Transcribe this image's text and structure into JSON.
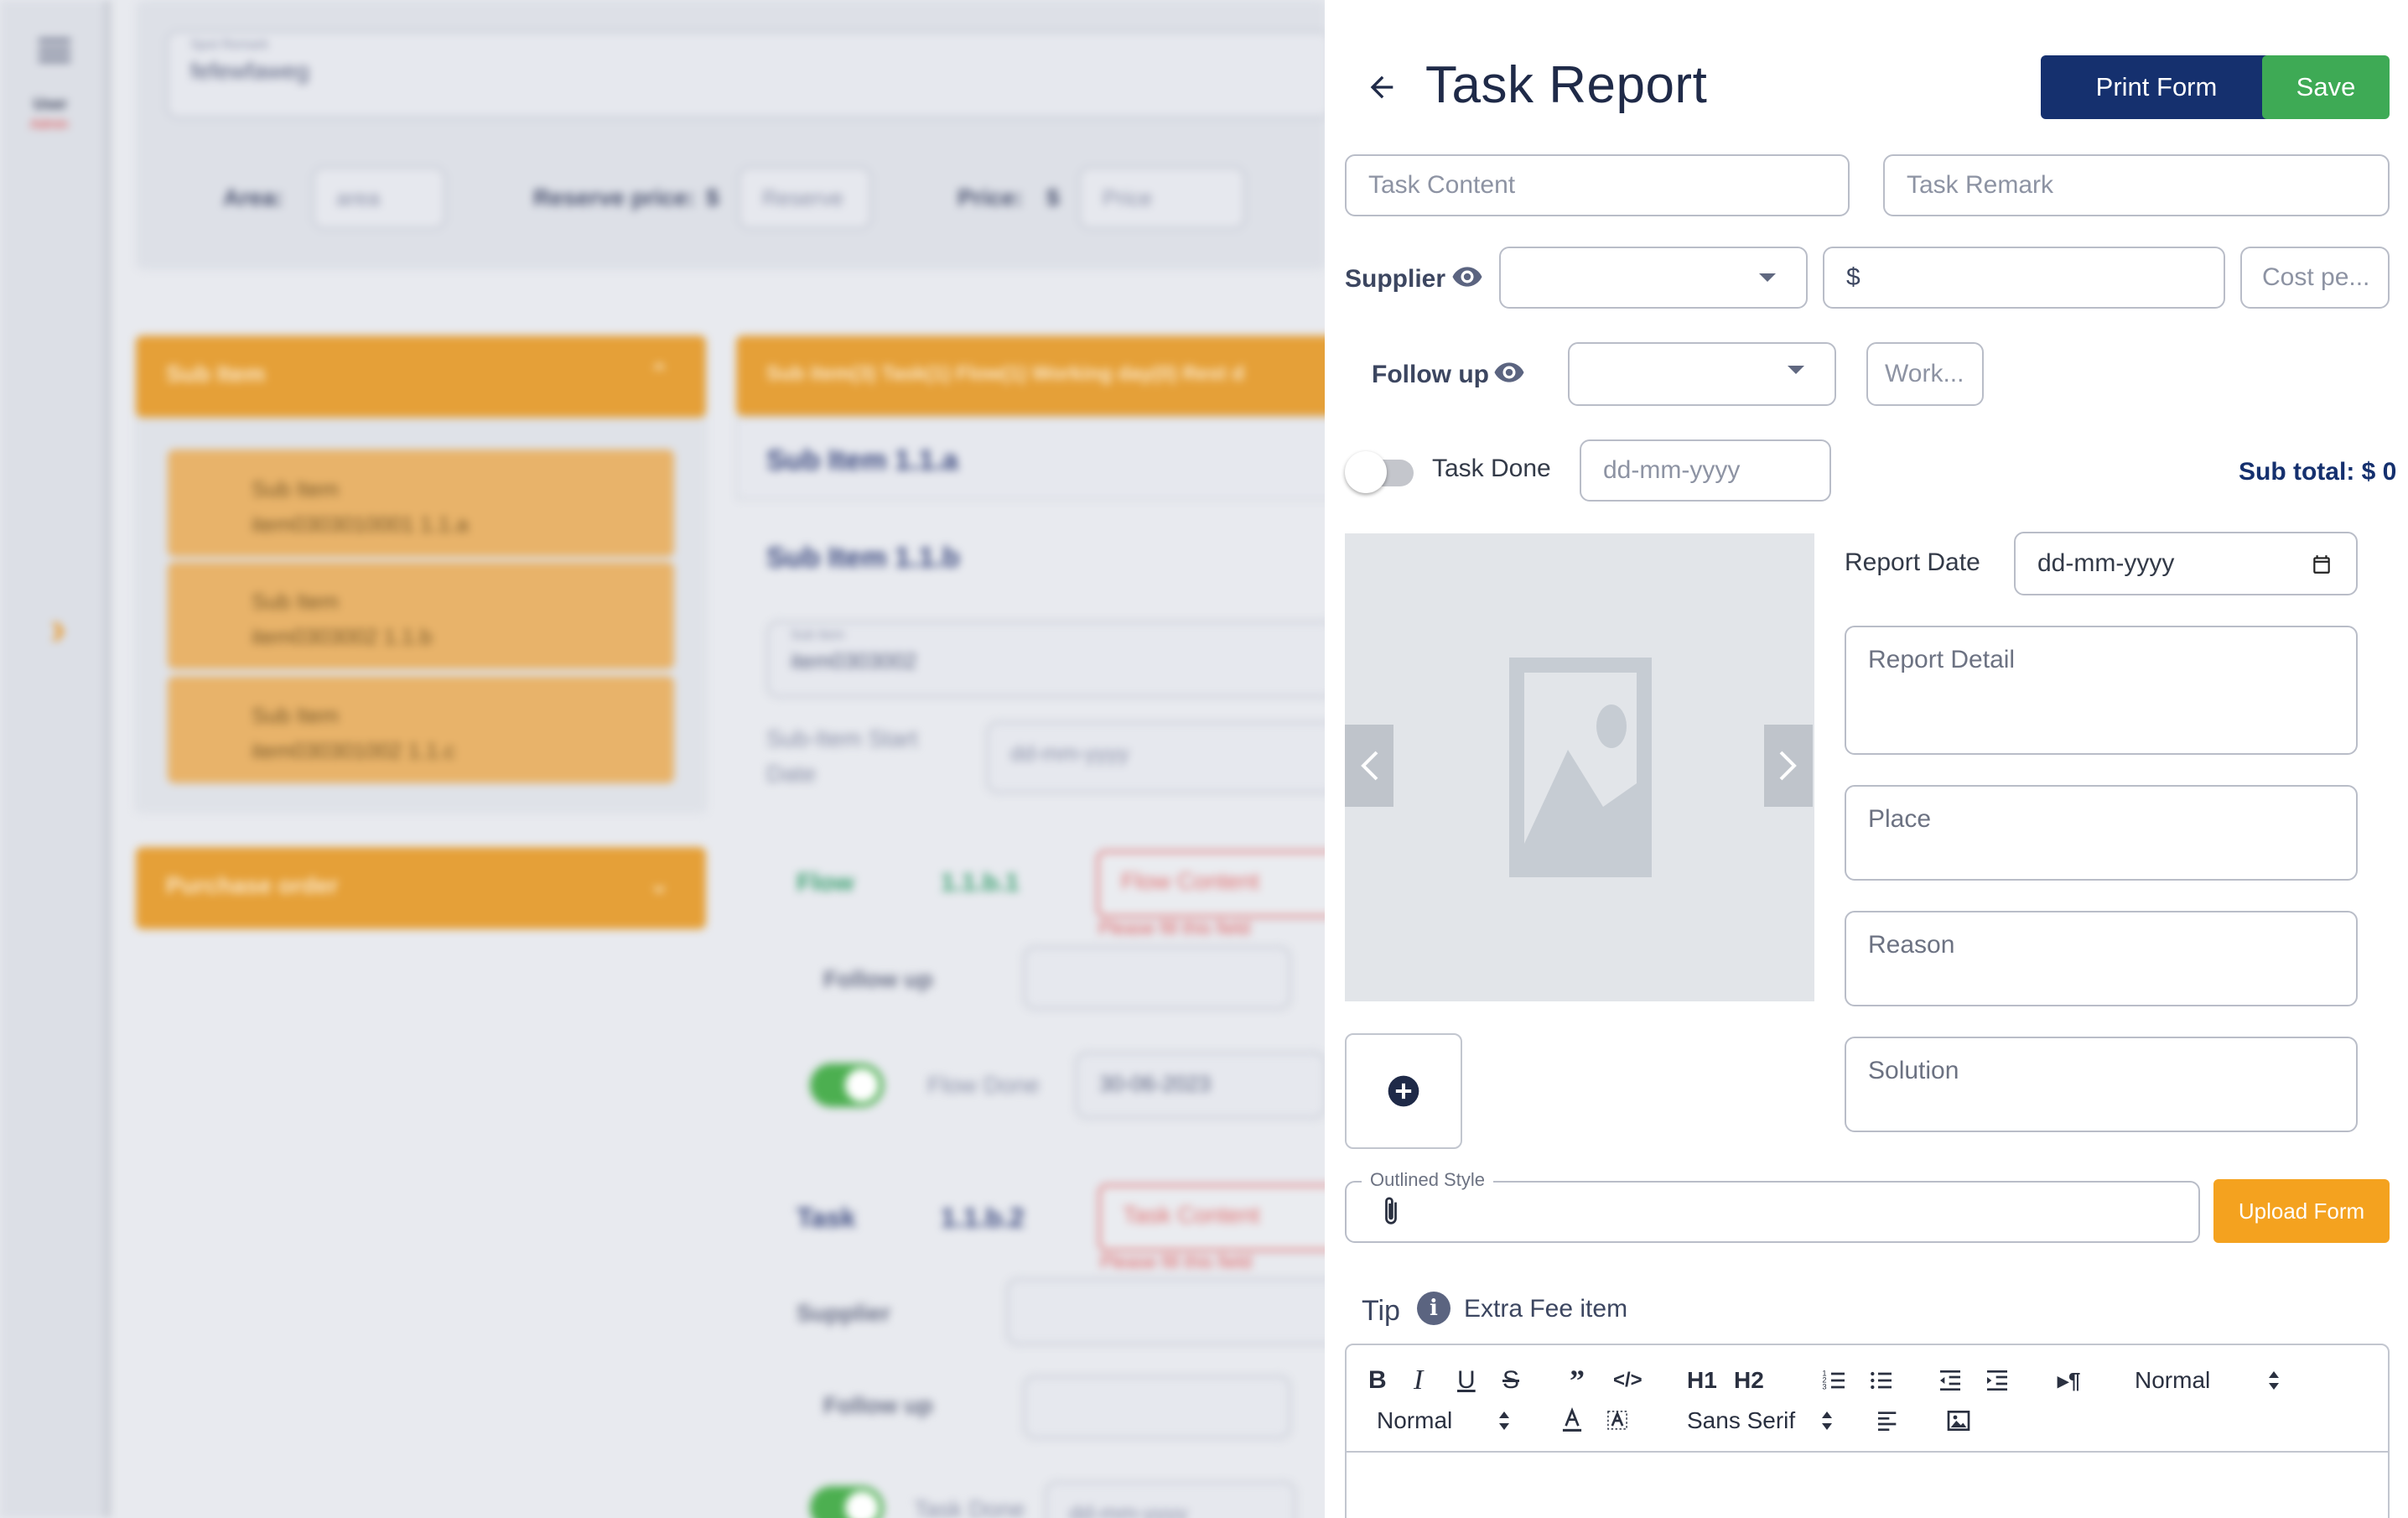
{
  "background": {
    "sidebar": {
      "user_label": "User",
      "role_label": "Admin"
    },
    "top_form": {
      "spot_remark_label": "Spot Remark",
      "spot_remark_value": "fefewfaweg",
      "area_label": "Area:",
      "area_placeholder": "area",
      "reserve_price_label": "Reserve price:",
      "reserve_currency": "$",
      "reserve_placeholder": "Reserve",
      "price_label": "Price:",
      "price_currency": "$",
      "price_placeholder": "Price"
    },
    "sub_item_panel": {
      "header": "Sub Item",
      "items": [
        {
          "title": "Sub Item",
          "code": "item0303010001 1.1.a"
        },
        {
          "title": "Sub Item",
          "code": "item0303002 1.1.b"
        },
        {
          "title": "Sub Item",
          "code": "item030301002 1.1.c"
        }
      ]
    },
    "purchase_order_header": "Purchase order",
    "tabs_bar": "Sub item(3)  Task(1)  Flow(1)  Working day(0)  Rest d",
    "detail": {
      "sub_item_a": "Sub Item 1.1.a",
      "sub_item_b": "Sub Item 1.1.b",
      "sub_item_field_label": "Sub Item",
      "sub_item_field_value": "item0303002",
      "start_date_label_1": "Sub-Item Start",
      "start_date_label_2": "Date",
      "start_date_value": "dd-mm-yyyy",
      "flow_label": "Flow",
      "flow_code": "1.1.b.1",
      "flow_content_placeholder": "Flow Content",
      "flow_error": "Please fill this field",
      "follow_up_label": "Follow up",
      "flow_done_label": "Flow Done",
      "flow_done_date": "30-06-2023",
      "task_label": "Task",
      "task_code": "1.1.b.2",
      "task_content_placeholder": "Task Content",
      "task_error": "Please fill this field",
      "supplier_label": "Supplier",
      "follow_up_label_2": "Follow up",
      "task_done_label": "Task Done",
      "task_done_date": "dd-mm-yyyy"
    }
  },
  "drawer": {
    "title": "Task Report",
    "print_button": "Print Form",
    "save_button": "Save",
    "task_content_placeholder": "Task Content",
    "task_remark_placeholder": "Task Remark",
    "supplier_label": "Supplier",
    "supplier_selected": "",
    "currency_symbol": "$",
    "cost_placeholder": "Cost pe...",
    "follow_up_label": "Follow up",
    "follow_up_selected": "",
    "work_placeholder": "Work...",
    "task_done_label": "Task Done",
    "task_done_on": false,
    "task_done_date_placeholder": "dd-mm-yyyy",
    "sub_total": "Sub total: $ 0",
    "report_date_label": "Report Date",
    "report_date_value": "dd-mm-yyyy",
    "report_detail_placeholder": "Report Detail",
    "place_placeholder": "Place",
    "reason_placeholder": "Reason",
    "solution_placeholder": "Solution",
    "outlined_style_label": "Outlined Style",
    "upload_button": "Upload Form",
    "tip_label": "Tip",
    "extra_fee_label": "Extra Fee item",
    "editor": {
      "heading1": "H1",
      "heading2": "H2",
      "header_select": "Normal",
      "size_select": "Normal",
      "font_select": "Sans Serif"
    }
  },
  "colors": {
    "primary_navy": "#15306e",
    "save_green": "#3eaa55",
    "upload_orange": "#f4a21f",
    "bg_orange": "#e5a038"
  }
}
